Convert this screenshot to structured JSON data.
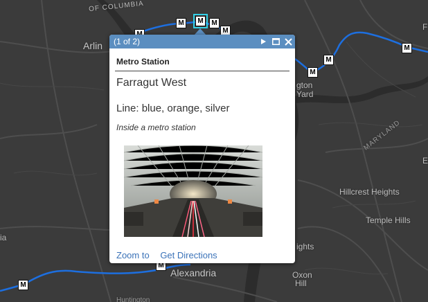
{
  "map": {
    "labels": {
      "arlington": "Arlin",
      "columbia": "OF COLUMBIA",
      "navy_yard_1": "gton",
      "navy_yard_2": "Yard",
      "maryland": "MARYLAND",
      "hillcrest": "Hillcrest Heights",
      "temple_hills": "Temple Hills",
      "alexandria": "Alexandria",
      "oxon_hill_1": "Oxon",
      "oxon_hill_2": "Hill",
      "heights": "ights",
      "left_edge": "ia",
      "right_e": "E",
      "right_f": "Fa",
      "huntington": "Huntington"
    },
    "metro_glyph": "M",
    "colors": {
      "background": "#3b3b3b",
      "metro_line": "#1d6fe0",
      "selection": "#33d0e6"
    }
  },
  "popup": {
    "counter": "(1 of 2)",
    "heading": "Metro Station",
    "station_name": "Farragut West",
    "lines": "Line: blue, orange, silver",
    "caption": "Inside a metro station",
    "zoom_to": "Zoom to",
    "get_directions": "Get Directions",
    "header_color": "#5b8ec0",
    "link_color": "#3a72b8"
  }
}
